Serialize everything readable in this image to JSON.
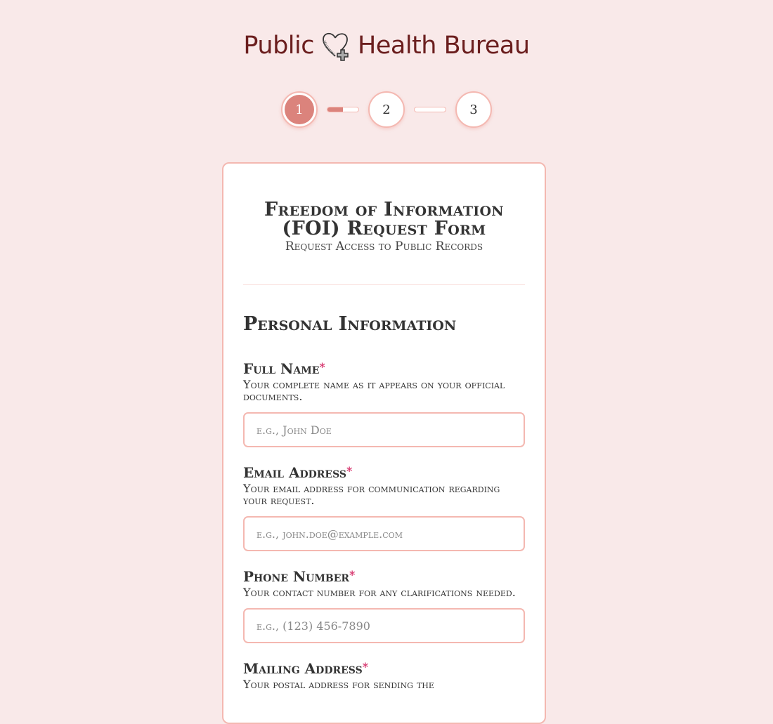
{
  "brand": {
    "left": "Public",
    "right": "Health Bureau",
    "logo_icon": "heart-medical-cross-icon"
  },
  "stepper": {
    "steps": [
      {
        "label": "1",
        "state": "active"
      },
      {
        "label": "2",
        "state": "pending"
      },
      {
        "label": "3",
        "state": "pending"
      }
    ],
    "connectors": [
      {
        "progress": 0.5
      },
      {
        "progress": 0
      }
    ]
  },
  "form": {
    "title": "Freedom of Information (FOI) Request Form",
    "subtitle": "Request Access to Public Records",
    "section_title": "Personal Information",
    "required_mark": "*",
    "fields": [
      {
        "label": "Full Name",
        "hint": "Your complete name as it appears on your official documents.",
        "placeholder": "e.g., John Doe",
        "value": ""
      },
      {
        "label": "Email Address",
        "hint": "Your email address for communication regarding your request.",
        "placeholder": "e.g., john.doe@example.com",
        "value": ""
      },
      {
        "label": "Phone Number",
        "hint": "Your contact number for any clarifications needed.",
        "placeholder": "e.g., (123) 456-7890",
        "value": ""
      },
      {
        "label": "Mailing Address",
        "hint": "Your postal address for sending the",
        "placeholder": "",
        "value": ""
      }
    ]
  },
  "colors": {
    "background": "#f9e9e9",
    "accent": "#db837c",
    "border": "#f4b8b1",
    "brand_text": "#6b1e1e",
    "required": "#d6336c"
  }
}
